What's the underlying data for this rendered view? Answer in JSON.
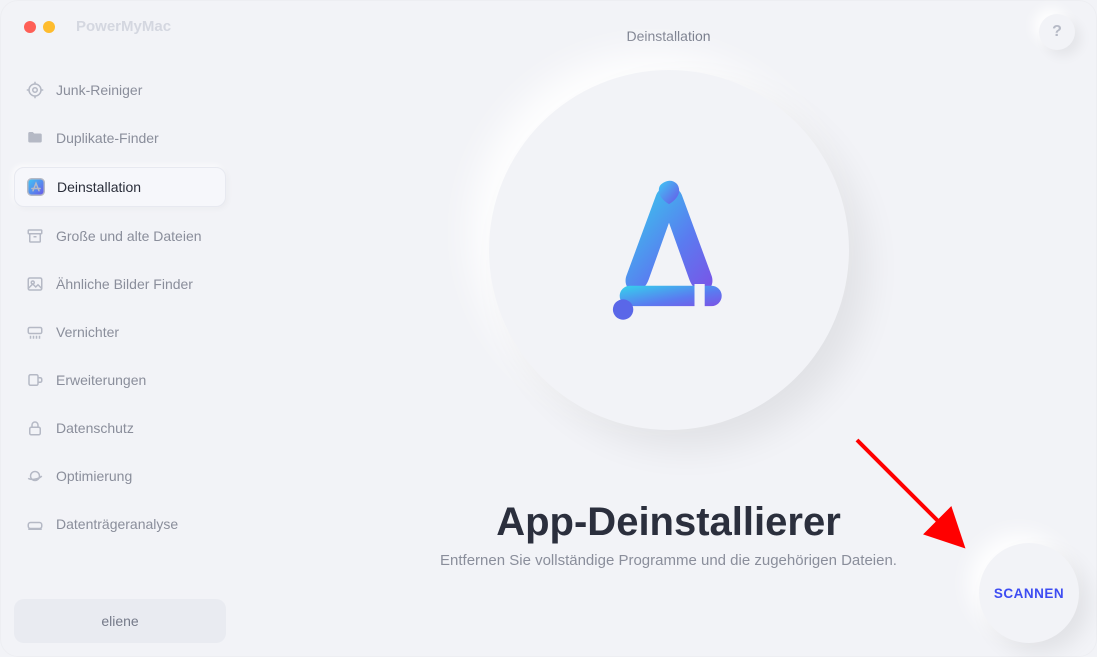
{
  "app": {
    "name": "PowerMyMac"
  },
  "header": {
    "title": "Deinstallation",
    "help": "?"
  },
  "sidebar": {
    "items": [
      {
        "label": "Junk-Reiniger"
      },
      {
        "label": "Duplikate-Finder"
      },
      {
        "label": "Deinstallation"
      },
      {
        "label": "Große und alte Dateien"
      },
      {
        "label": "Ähnliche Bilder Finder"
      },
      {
        "label": "Vernichter"
      },
      {
        "label": "Erweiterungen"
      },
      {
        "label": "Datenschutz"
      },
      {
        "label": "Optimierung"
      },
      {
        "label": "Datenträgeranalyse"
      }
    ],
    "user_label": "eliene"
  },
  "main": {
    "title": "App-Deinstallierer",
    "subtitle": "Entfernen Sie vollständige Programme und die zugehörigen Dateien.",
    "scan_label": "SCANNEN"
  }
}
